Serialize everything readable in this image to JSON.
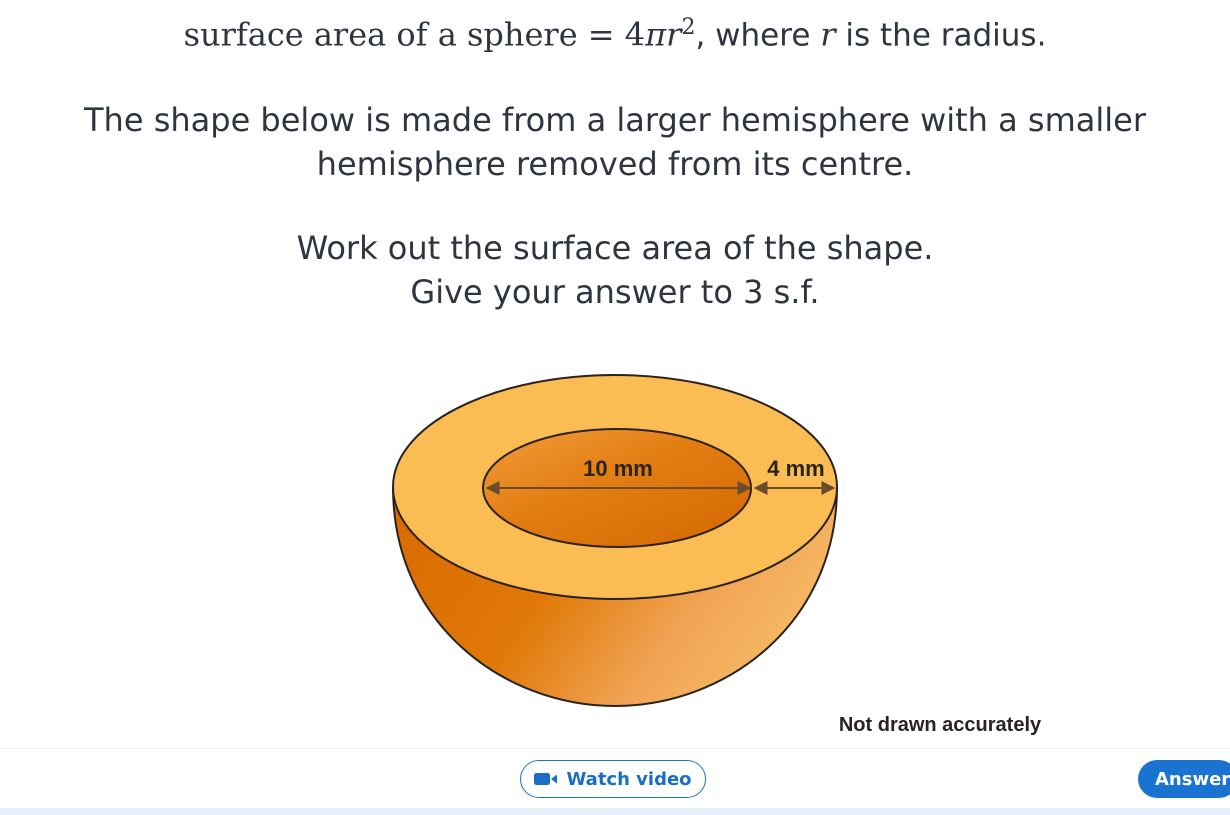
{
  "formula": {
    "text_before": "surface area of a sphere = 4",
    "pi": "π",
    "r": "r",
    "exponent": "2",
    "text_after": ", where ",
    "r2": "r",
    "text_end": " is the radius."
  },
  "question": {
    "line1": "The shape below is made from a larger hemisphere with a smaller",
    "line2": "hemisphere removed from its centre.",
    "line3": "Work out the surface area of the shape.",
    "line4": "Give your answer to 3 s.f."
  },
  "figure": {
    "label_diameter": "10 mm",
    "label_thickness": "4 mm",
    "note": "Not drawn accurately",
    "colors": {
      "rim": "#fbbd53",
      "outer_dark": "#dc6f05",
      "outer_light": "#f6b05a",
      "inner_dark": "#d86a04",
      "inner_light": "#f09a36",
      "outline": "#2b2320",
      "arrow": "#6b4b2c"
    }
  },
  "footer": {
    "watch_video_label": "Watch video",
    "answer_label": "Answer",
    "video_icon": "video-camera-icon",
    "accent": "#1a73d0"
  }
}
